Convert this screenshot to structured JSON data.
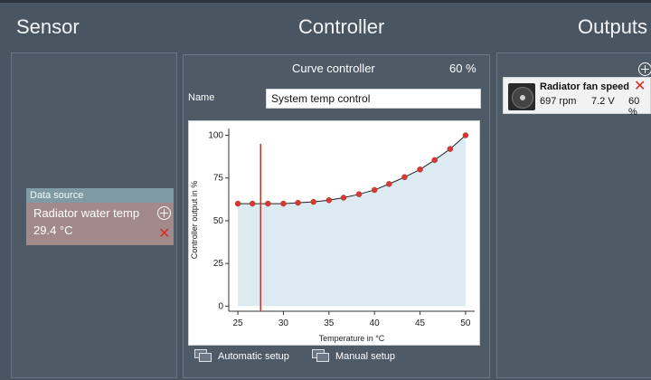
{
  "sections": {
    "sensor": "Sensor",
    "controller": "Controller",
    "outputs": "Outputs"
  },
  "data_source": {
    "header": "Data source",
    "name": "Radiator water temp",
    "value": "29.4 °C"
  },
  "controller": {
    "type": "Curve controller",
    "percent": "60 %",
    "name_label": "Name",
    "name_value": "System temp control",
    "auto_setup": "Automatic setup",
    "manual_setup": "Manual setup"
  },
  "output": {
    "name": "Radiator fan speed",
    "rpm": "697 rpm",
    "voltage": "7.2 V",
    "percent": "60 %"
  },
  "colors": {
    "accent_red": "#c0392b",
    "area_fill": "#dcebf2",
    "delete_red": "#d42b2b"
  },
  "chart_data": {
    "type": "line",
    "xlabel": "Temperature in °C",
    "ylabel": "Controller output in %",
    "xlim": [
      24,
      51
    ],
    "ylim": [
      -3,
      104
    ],
    "xticks": [
      25,
      30,
      35,
      40,
      45,
      50
    ],
    "yticks": [
      0,
      25,
      50,
      75,
      100
    ],
    "current_x": 27.5,
    "points": [
      [
        25,
        60
      ],
      [
        26.6,
        60
      ],
      [
        28.3,
        60
      ],
      [
        30,
        60
      ],
      [
        31.6,
        60.5
      ],
      [
        33.3,
        61
      ],
      [
        35,
        62
      ],
      [
        36.6,
        63.5
      ],
      [
        38.3,
        65.5
      ],
      [
        40,
        68
      ],
      [
        41.6,
        71.5
      ],
      [
        43.3,
        75.5
      ],
      [
        45,
        80
      ],
      [
        46.6,
        85.5
      ],
      [
        48.3,
        92
      ],
      [
        50,
        100
      ]
    ]
  }
}
